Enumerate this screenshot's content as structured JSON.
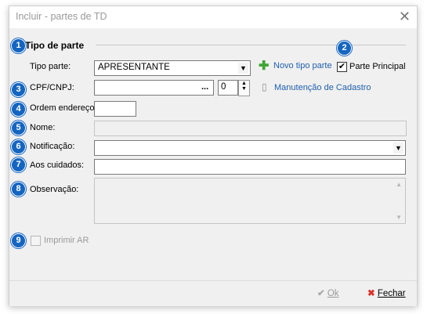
{
  "window": {
    "title": "Incluir - partes de TD",
    "close_glyph": "✕"
  },
  "group": {
    "title": "Tipo de parte"
  },
  "badges": [
    "1",
    "2",
    "3",
    "4",
    "5",
    "6",
    "7",
    "8",
    "9"
  ],
  "fields": {
    "tipo_parte": {
      "label": "Tipo parte:",
      "value": "APRESENTANTE"
    },
    "cpf": {
      "label": "CPF/CNPJ:",
      "value": "",
      "ellipsis": "...",
      "spin_value": "0"
    },
    "ordem": {
      "label": "Ordem endereço:",
      "value": ""
    },
    "nome": {
      "label": "Nome:",
      "value": ""
    },
    "notificacao": {
      "label": "Notificação:",
      "value": ""
    },
    "aos_cuidados": {
      "label": "Aos cuidados:",
      "value": ""
    },
    "observacao": {
      "label": "Observação:",
      "value": ""
    }
  },
  "links": {
    "novo_tipo": "Novo tipo parte",
    "manutencao": "Manutenção de Cadastro"
  },
  "checkboxes": {
    "parte_principal": {
      "label": "Parte Principal",
      "checked": true
    },
    "imprimir_ar": {
      "label": "Imprimir AR",
      "checked": false
    }
  },
  "buttons": {
    "ok": "Ok",
    "fechar": "Fechar"
  },
  "colors": {
    "badge": "#1565c0",
    "link": "#1f5fae",
    "plus": "#3fa534",
    "close_x": "#d9342b"
  }
}
